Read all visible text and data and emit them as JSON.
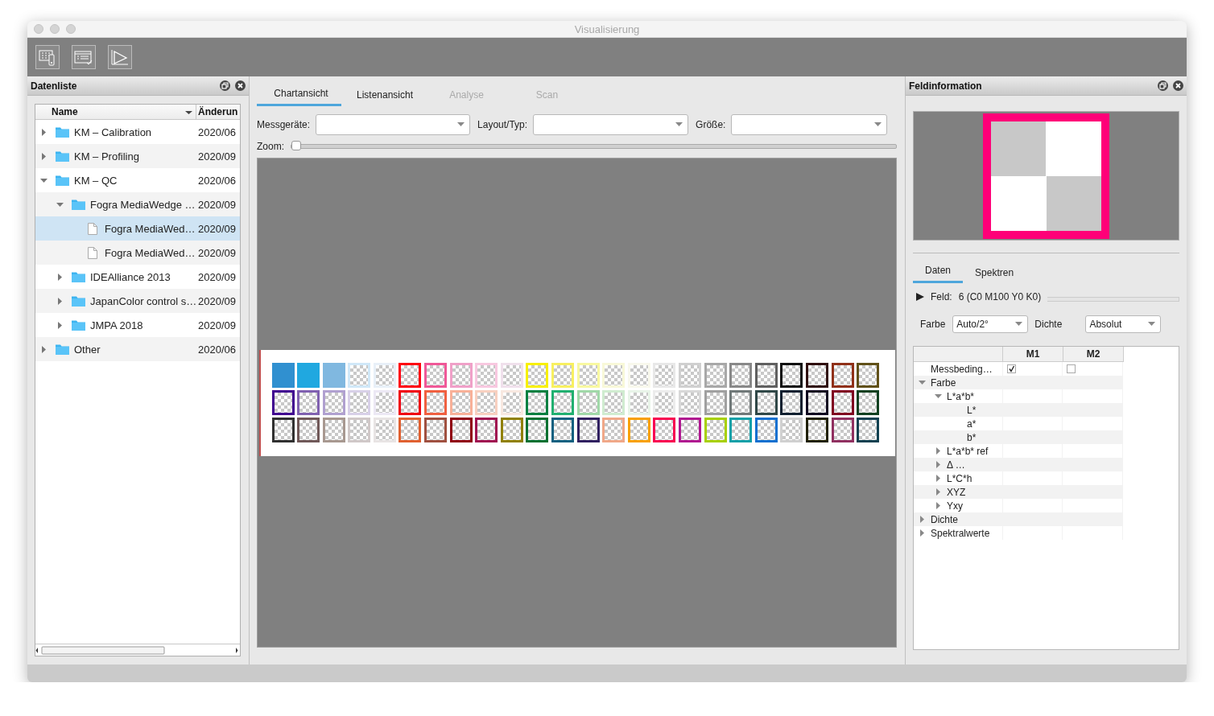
{
  "window": {
    "title": "Visualisierung"
  },
  "toolbar": {
    "buttons": [
      {
        "kind": "chart-device"
      },
      {
        "kind": "list-check"
      },
      {
        "kind": "plot"
      }
    ]
  },
  "data_list": {
    "title": "Datenliste",
    "columns": [
      "Name",
      "Änderun"
    ],
    "items": [
      {
        "name": "KM – Calibration",
        "date": "2020/06",
        "kind": "folder",
        "expanded": false,
        "selected": false
      },
      {
        "name": "KM – Profiling",
        "date": "2020/09",
        "kind": "folder",
        "expanded": false,
        "selected": false
      },
      {
        "name": "KM – QC",
        "date": "2020/06",
        "kind": "folder",
        "expanded": true,
        "selected": false,
        "children": [
          {
            "name": "Fogra MediaWedge …",
            "date": "2020/09",
            "kind": "folder",
            "expanded": true,
            "selected": false,
            "children": [
              {
                "name": "Fogra MediaWed…",
                "date": "2020/09",
                "kind": "file",
                "selected": true
              },
              {
                "name": "Fogra MediaWed…",
                "date": "2020/09",
                "kind": "file",
                "selected": false
              }
            ]
          },
          {
            "name": "IDEAlliance 2013",
            "date": "2020/09",
            "kind": "folder",
            "expanded": false,
            "selected": false
          },
          {
            "name": "JapanColor control s…",
            "date": "2020/09",
            "kind": "folder",
            "expanded": false,
            "selected": false
          },
          {
            "name": "JMPA 2018",
            "date": "2020/09",
            "kind": "folder",
            "expanded": false,
            "selected": false
          }
        ]
      },
      {
        "name": "Other",
        "date": "2020/06",
        "kind": "folder",
        "expanded": false,
        "selected": false
      }
    ]
  },
  "chart_view": {
    "tabs": [
      {
        "label": "Chartansicht",
        "selected": true,
        "disabled": false
      },
      {
        "label": "Listenansicht",
        "selected": false,
        "disabled": false
      },
      {
        "label": "Analyse",
        "selected": false,
        "disabled": true
      },
      {
        "label": "Scan",
        "selected": false,
        "disabled": true
      }
    ],
    "filters": [
      {
        "label": "Messgeräte:"
      },
      {
        "label": "Layout/Typ:"
      },
      {
        "label": "Größe:"
      }
    ],
    "zoom": {
      "label": "Zoom:",
      "level": 0
    },
    "patches": [
      [
        {
          "color": "#3090d0",
          "kind": "solid"
        },
        {
          "color": "#20a8e0",
          "kind": "solid"
        },
        {
          "color": "#80b8e0",
          "kind": "solid"
        },
        {
          "color": "#d0e8f8",
          "kind": "checker"
        },
        {
          "color": "#e8f0f8",
          "kind": "checker"
        },
        {
          "color": "#ff0010",
          "kind": "checker"
        },
        {
          "color": "#f05898",
          "kind": "checker"
        },
        {
          "color": "#f0a0c8",
          "kind": "checker"
        },
        {
          "color": "#f8c8e0",
          "kind": "checker"
        },
        {
          "color": "#f0e0ec",
          "kind": "checker"
        },
        {
          "color": "#f8f000",
          "kind": "checker"
        },
        {
          "color": "#f8f060",
          "kind": "checker"
        },
        {
          "color": "#f8f8a0",
          "kind": "checker"
        },
        {
          "color": "#f8f8d8",
          "kind": "checker"
        },
        {
          "color": "#f8f8ec",
          "kind": "checker"
        },
        {
          "color": "#e8e8e8",
          "kind": "checker"
        },
        {
          "color": "#d0d0d0",
          "kind": "checker"
        },
        {
          "color": "#a8a8a8",
          "kind": "checker"
        },
        {
          "color": "#888888",
          "kind": "checker"
        },
        {
          "color": "#606060",
          "kind": "checker"
        },
        {
          "color": "#101010",
          "kind": "checker"
        },
        {
          "color": "#301010",
          "kind": "checker"
        },
        {
          "color": "#903018",
          "kind": "checker"
        },
        {
          "color": "#605018",
          "kind": "checker"
        }
      ],
      [
        {
          "color": "#400090",
          "kind": "checker"
        },
        {
          "color": "#8060b0",
          "kind": "checker"
        },
        {
          "color": "#b0a0d0",
          "kind": "checker"
        },
        {
          "color": "#d8d0e8",
          "kind": "checker"
        },
        {
          "color": "#ece8f4",
          "kind": "checker"
        },
        {
          "color": "#f00010",
          "kind": "checker"
        },
        {
          "color": "#f06040",
          "kind": "checker"
        },
        {
          "color": "#f8b098",
          "kind": "checker"
        },
        {
          "color": "#f8d0c0",
          "kind": "checker"
        },
        {
          "color": "#f8e8e0",
          "kind": "checker"
        },
        {
          "color": "#008040",
          "kind": "checker"
        },
        {
          "color": "#20b070",
          "kind": "checker"
        },
        {
          "color": "#a0d8a8",
          "kind": "checker"
        },
        {
          "color": "#d0ecd0",
          "kind": "checker"
        },
        {
          "color": "#e8f4e8",
          "kind": "checker"
        },
        {
          "color": "#ececec",
          "kind": "checker"
        },
        {
          "color": "#d8d8d8",
          "kind": "checker"
        },
        {
          "color": "#a0a0a0",
          "kind": "checker"
        },
        {
          "color": "#707878",
          "kind": "checker"
        },
        {
          "color": "#304848",
          "kind": "checker"
        },
        {
          "color": "#102030",
          "kind": "checker"
        },
        {
          "color": "#100820",
          "kind": "checker"
        },
        {
          "color": "#800020",
          "kind": "checker"
        },
        {
          "color": "#104020",
          "kind": "checker"
        }
      ],
      [
        {
          "color": "#303030",
          "kind": "checker"
        },
        {
          "color": "#705858",
          "kind": "checker"
        },
        {
          "color": "#a89890",
          "kind": "checker"
        },
        {
          "color": "#d0c8c8",
          "kind": "checker"
        },
        {
          "color": "#e8e4e4",
          "kind": "checker"
        },
        {
          "color": "#e06030",
          "kind": "checker"
        },
        {
          "color": "#a05040",
          "kind": "checker"
        },
        {
          "color": "#900010",
          "kind": "checker"
        },
        {
          "color": "#a01050",
          "kind": "checker"
        },
        {
          "color": "#908000",
          "kind": "checker"
        },
        {
          "color": "#007030",
          "kind": "checker"
        },
        {
          "color": "#106080",
          "kind": "checker"
        },
        {
          "color": "#302060",
          "kind": "checker"
        },
        {
          "color": "#f0a888",
          "kind": "checker"
        },
        {
          "color": "#f8a000",
          "kind": "checker"
        },
        {
          "color": "#f80050",
          "kind": "checker"
        },
        {
          "color": "#b01890",
          "kind": "checker"
        },
        {
          "color": "#a8d000",
          "kind": "checker"
        },
        {
          "color": "#10a0a8",
          "kind": "checker"
        },
        {
          "color": "#1070d0",
          "kind": "checker"
        },
        {
          "color": "#d0d0d0",
          "kind": "checker"
        },
        {
          "color": "#202000",
          "kind": "checker"
        },
        {
          "color": "#903060",
          "kind": "checker"
        },
        {
          "color": "#104050",
          "kind": "checker"
        }
      ]
    ]
  },
  "field_info": {
    "title": "Feldinformation",
    "preview": {
      "color": "#ff0078"
    },
    "tabs": [
      {
        "label": "Daten",
        "selected": true
      },
      {
        "label": "Spektren",
        "selected": false
      }
    ],
    "field": {
      "label": "Feld:",
      "value": "6 (C0 M100 Y0 K0)"
    },
    "options": [
      {
        "label": "Farbe",
        "value": "Auto/2°"
      },
      {
        "label": "Dichte",
        "value": "Absolut"
      }
    ],
    "columns": [
      "M1",
      "M2"
    ],
    "rows": [
      {
        "label": "Messbeding…",
        "kind": "check",
        "m1_checked": true,
        "m2_checked": false
      },
      {
        "label": "Farbe",
        "kind": "group",
        "expanded": true,
        "children": [
          {
            "label": "L*a*b*",
            "kind": "group",
            "expanded": true,
            "children": [
              {
                "label": "L*",
                "kind": "value"
              },
              {
                "label": "a*",
                "kind": "value"
              },
              {
                "label": "b*",
                "kind": "value"
              }
            ]
          },
          {
            "label": "L*a*b* ref",
            "kind": "group",
            "expanded": false
          },
          {
            "label": "Δ …",
            "kind": "group",
            "expanded": false
          },
          {
            "label": "L*C*h",
            "kind": "group",
            "expanded": false
          },
          {
            "label": "XYZ",
            "kind": "group",
            "expanded": false
          },
          {
            "label": "Yxy",
            "kind": "group",
            "expanded": false
          }
        ]
      },
      {
        "label": "Dichte",
        "kind": "group",
        "expanded": false
      },
      {
        "label": "Spektralwerte",
        "kind": "group",
        "expanded": false
      }
    ]
  }
}
